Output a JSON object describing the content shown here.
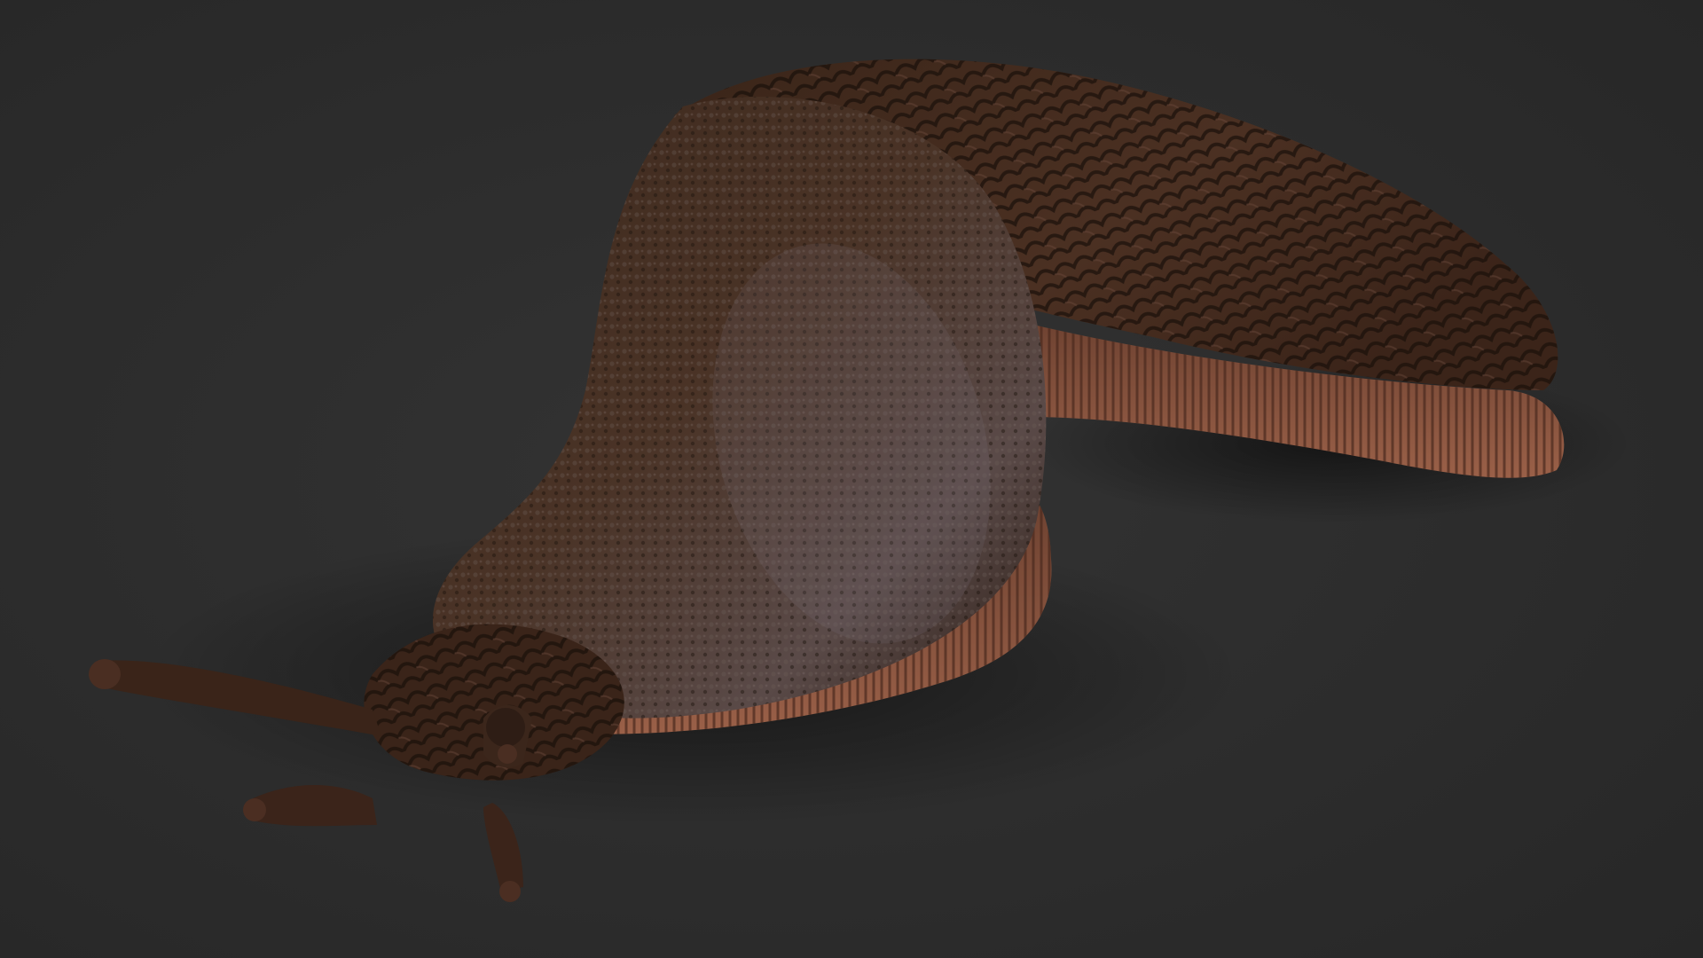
{
  "scene": {
    "subject_icon": "slug-icon",
    "colors": {
      "background": "#2c2c2c",
      "body_dark": "#2a1a12",
      "body_mid": "#4a3022",
      "body_highlight": "#7d6a66",
      "foot_fringe": "#8a5640",
      "tentacle": "#3a2419"
    }
  }
}
